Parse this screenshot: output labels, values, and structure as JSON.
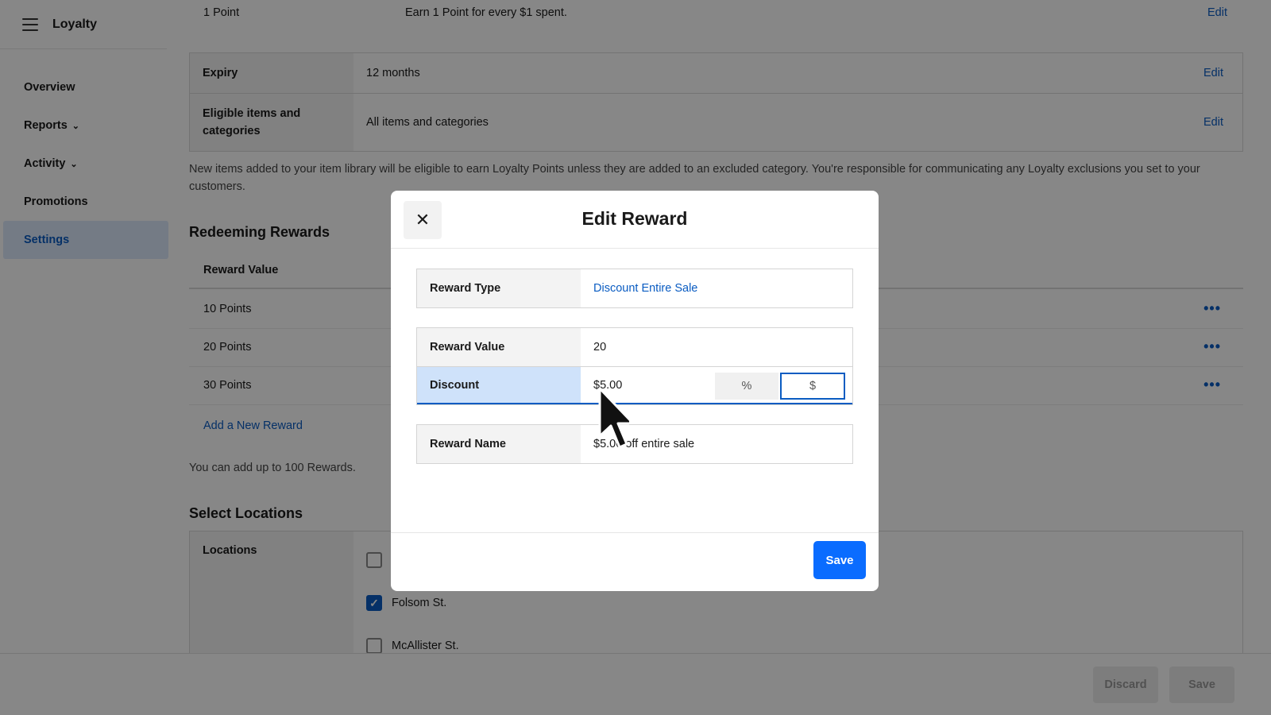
{
  "app": {
    "title": "Loyalty"
  },
  "sidebar": {
    "items": [
      {
        "label": "Overview",
        "has_chevron": false
      },
      {
        "label": "Reports",
        "has_chevron": true
      },
      {
        "label": "Activity",
        "has_chevron": true
      },
      {
        "label": "Promotions",
        "has_chevron": false
      },
      {
        "label": "Settings",
        "has_chevron": false,
        "active": true
      }
    ]
  },
  "earning": {
    "rule_label": "1 Point",
    "rule_value": "Earn 1 Point for every $1 spent.",
    "edit_label": "Edit"
  },
  "settings_table": {
    "rows": [
      {
        "label": "Expiry",
        "value": "12 months",
        "edit": "Edit"
      },
      {
        "label": "Eligible items and categories",
        "value": "All items and categories",
        "edit": "Edit"
      }
    ]
  },
  "notice": "New items added to your item library will be eligible to earn Loyalty Points unless they are added to an excluded category. You're responsible for communicating any Loyalty exclusions you set to your customers.",
  "redeeming": {
    "heading": "Redeeming Rewards",
    "column": "Reward Value",
    "rows": [
      "10 Points",
      "20 Points",
      "30 Points"
    ],
    "more_icon": "more-horizontal-icon",
    "add_label": "Add a New Reward",
    "hint": "You can add up to 100 Rewards."
  },
  "locations": {
    "heading": "Select Locations",
    "label": "Locations",
    "items": [
      {
        "name": "",
        "checked": false
      },
      {
        "name": "Folsom St.",
        "checked": true
      },
      {
        "name": "McAllister St.",
        "checked": false
      }
    ]
  },
  "bottom_bar": {
    "discard_label": "Discard",
    "save_label": "Save"
  },
  "modal": {
    "title": "Edit Reward",
    "close_icon": "close-icon",
    "reward_type_label": "Reward Type",
    "reward_type_value": "Discount Entire Sale",
    "reward_value_label": "Reward Value",
    "reward_value_value": "20",
    "discount_label": "Discount",
    "discount_value": "$5.00",
    "unit_percent": "%",
    "unit_dollar": "$",
    "reward_name_label": "Reward Name",
    "reward_name_value": "$5.00 off entire sale",
    "save_label": "Save"
  },
  "colors": {
    "accent": "#0a5cc2",
    "primary_button": "#0a6cff",
    "overlay": "rgba(0,0,0,0.47)"
  }
}
